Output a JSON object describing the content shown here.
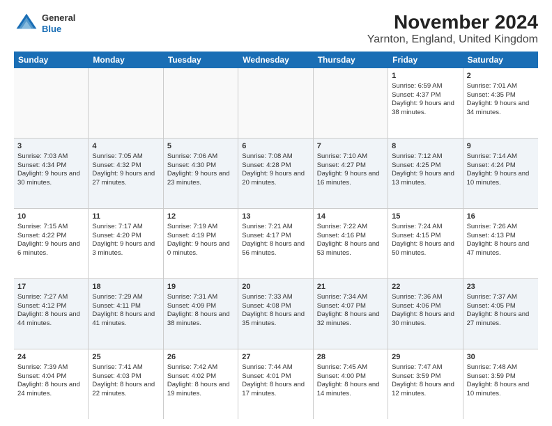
{
  "header": {
    "logo_line1": "General",
    "logo_line2": "Blue",
    "title": "November 2024",
    "subtitle": "Yarnton, England, United Kingdom"
  },
  "days_of_week": [
    "Sunday",
    "Monday",
    "Tuesday",
    "Wednesday",
    "Thursday",
    "Friday",
    "Saturday"
  ],
  "rows": [
    [
      {
        "day": "",
        "info": ""
      },
      {
        "day": "",
        "info": ""
      },
      {
        "day": "",
        "info": ""
      },
      {
        "day": "",
        "info": ""
      },
      {
        "day": "",
        "info": ""
      },
      {
        "day": "1",
        "info": "Sunrise: 6:59 AM\nSunset: 4:37 PM\nDaylight: 9 hours and 38 minutes."
      },
      {
        "day": "2",
        "info": "Sunrise: 7:01 AM\nSunset: 4:35 PM\nDaylight: 9 hours and 34 minutes."
      }
    ],
    [
      {
        "day": "3",
        "info": "Sunrise: 7:03 AM\nSunset: 4:34 PM\nDaylight: 9 hours and 30 minutes."
      },
      {
        "day": "4",
        "info": "Sunrise: 7:05 AM\nSunset: 4:32 PM\nDaylight: 9 hours and 27 minutes."
      },
      {
        "day": "5",
        "info": "Sunrise: 7:06 AM\nSunset: 4:30 PM\nDaylight: 9 hours and 23 minutes."
      },
      {
        "day": "6",
        "info": "Sunrise: 7:08 AM\nSunset: 4:28 PM\nDaylight: 9 hours and 20 minutes."
      },
      {
        "day": "7",
        "info": "Sunrise: 7:10 AM\nSunset: 4:27 PM\nDaylight: 9 hours and 16 minutes."
      },
      {
        "day": "8",
        "info": "Sunrise: 7:12 AM\nSunset: 4:25 PM\nDaylight: 9 hours and 13 minutes."
      },
      {
        "day": "9",
        "info": "Sunrise: 7:14 AM\nSunset: 4:24 PM\nDaylight: 9 hours and 10 minutes."
      }
    ],
    [
      {
        "day": "10",
        "info": "Sunrise: 7:15 AM\nSunset: 4:22 PM\nDaylight: 9 hours and 6 minutes."
      },
      {
        "day": "11",
        "info": "Sunrise: 7:17 AM\nSunset: 4:20 PM\nDaylight: 9 hours and 3 minutes."
      },
      {
        "day": "12",
        "info": "Sunrise: 7:19 AM\nSunset: 4:19 PM\nDaylight: 9 hours and 0 minutes."
      },
      {
        "day": "13",
        "info": "Sunrise: 7:21 AM\nSunset: 4:17 PM\nDaylight: 8 hours and 56 minutes."
      },
      {
        "day": "14",
        "info": "Sunrise: 7:22 AM\nSunset: 4:16 PM\nDaylight: 8 hours and 53 minutes."
      },
      {
        "day": "15",
        "info": "Sunrise: 7:24 AM\nSunset: 4:15 PM\nDaylight: 8 hours and 50 minutes."
      },
      {
        "day": "16",
        "info": "Sunrise: 7:26 AM\nSunset: 4:13 PM\nDaylight: 8 hours and 47 minutes."
      }
    ],
    [
      {
        "day": "17",
        "info": "Sunrise: 7:27 AM\nSunset: 4:12 PM\nDaylight: 8 hours and 44 minutes."
      },
      {
        "day": "18",
        "info": "Sunrise: 7:29 AM\nSunset: 4:11 PM\nDaylight: 8 hours and 41 minutes."
      },
      {
        "day": "19",
        "info": "Sunrise: 7:31 AM\nSunset: 4:09 PM\nDaylight: 8 hours and 38 minutes."
      },
      {
        "day": "20",
        "info": "Sunrise: 7:33 AM\nSunset: 4:08 PM\nDaylight: 8 hours and 35 minutes."
      },
      {
        "day": "21",
        "info": "Sunrise: 7:34 AM\nSunset: 4:07 PM\nDaylight: 8 hours and 32 minutes."
      },
      {
        "day": "22",
        "info": "Sunrise: 7:36 AM\nSunset: 4:06 PM\nDaylight: 8 hours and 30 minutes."
      },
      {
        "day": "23",
        "info": "Sunrise: 7:37 AM\nSunset: 4:05 PM\nDaylight: 8 hours and 27 minutes."
      }
    ],
    [
      {
        "day": "24",
        "info": "Sunrise: 7:39 AM\nSunset: 4:04 PM\nDaylight: 8 hours and 24 minutes."
      },
      {
        "day": "25",
        "info": "Sunrise: 7:41 AM\nSunset: 4:03 PM\nDaylight: 8 hours and 22 minutes."
      },
      {
        "day": "26",
        "info": "Sunrise: 7:42 AM\nSunset: 4:02 PM\nDaylight: 8 hours and 19 minutes."
      },
      {
        "day": "27",
        "info": "Sunrise: 7:44 AM\nSunset: 4:01 PM\nDaylight: 8 hours and 17 minutes."
      },
      {
        "day": "28",
        "info": "Sunrise: 7:45 AM\nSunset: 4:00 PM\nDaylight: 8 hours and 14 minutes."
      },
      {
        "day": "29",
        "info": "Sunrise: 7:47 AM\nSunset: 3:59 PM\nDaylight: 8 hours and 12 minutes."
      },
      {
        "day": "30",
        "info": "Sunrise: 7:48 AM\nSunset: 3:59 PM\nDaylight: 8 hours and 10 minutes."
      }
    ]
  ]
}
